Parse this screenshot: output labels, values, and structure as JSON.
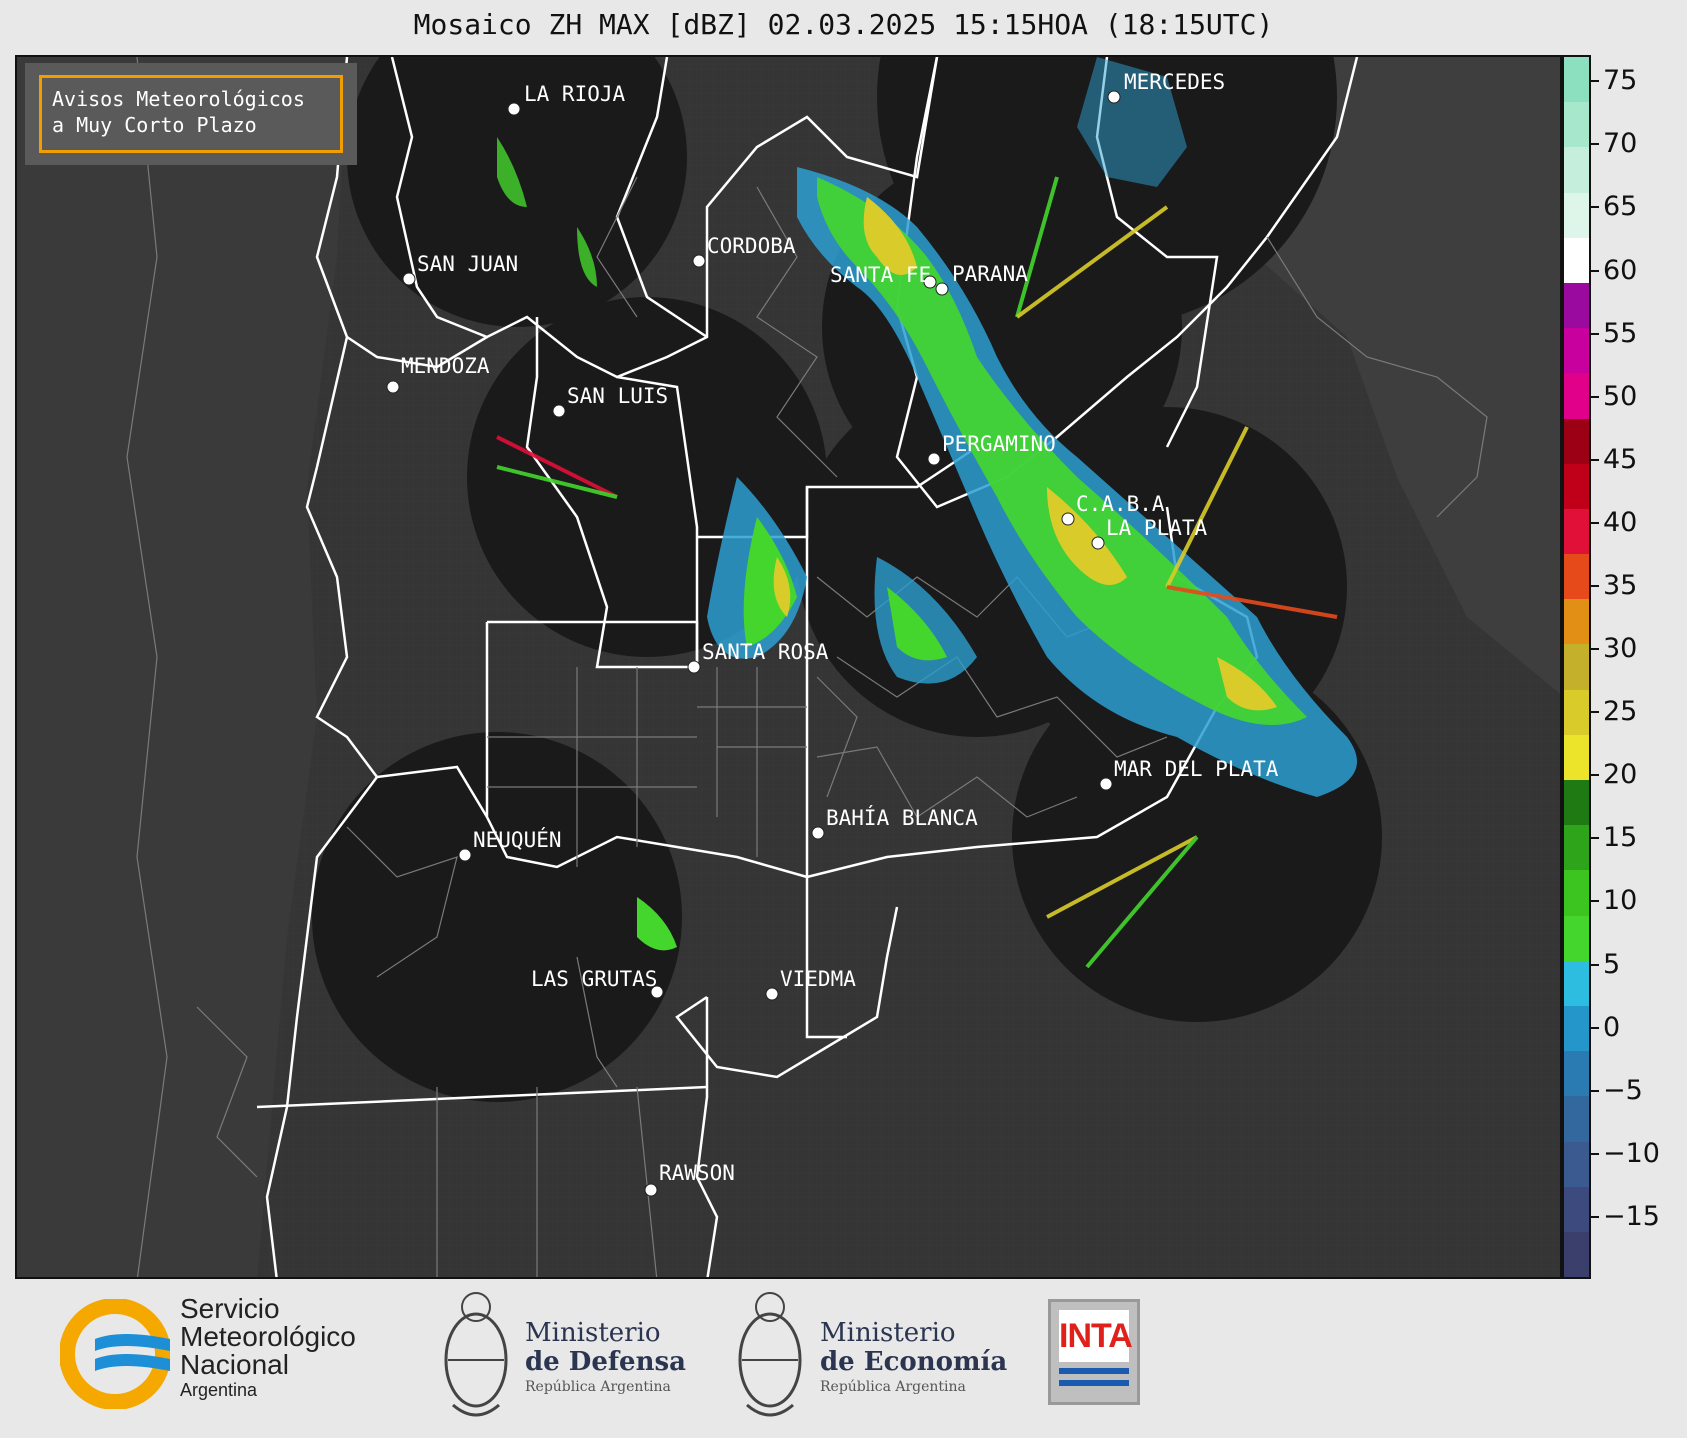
{
  "title": "Mosaico ZH MAX [dBZ] 02.03.2025 15:15HOA (18:15UTC)",
  "notice": {
    "line1": "Avisos Meteorológicos",
    "line2": "a Muy Corto Plazo",
    "border_color": "#f29d00"
  },
  "cities": [
    {
      "name": "LA RIOJA"
    },
    {
      "name": "MERCEDES"
    },
    {
      "name": "CORDOBA"
    },
    {
      "name": "SAN JUAN"
    },
    {
      "name": "SANTA FE"
    },
    {
      "name": "PARANA"
    },
    {
      "name": "MENDOZA"
    },
    {
      "name": "SAN LUIS"
    },
    {
      "name": "PERGAMINO"
    },
    {
      "name": "C.A.B.A"
    },
    {
      "name": "LA PLATA"
    },
    {
      "name": "SANTA ROSA"
    },
    {
      "name": "MAR DEL PLATA"
    },
    {
      "name": "BAHÍA BLANCA"
    },
    {
      "name": "NEUQUÉN"
    },
    {
      "name": "LAS GRUTAS"
    },
    {
      "name": "VIEDMA"
    },
    {
      "name": "RAWSON"
    }
  ],
  "colorbar": {
    "unit": "dBZ",
    "range": [
      -20,
      77
    ],
    "ticks": [
      "75",
      "70",
      "65",
      "60",
      "55",
      "50",
      "45",
      "40",
      "35",
      "30",
      "25",
      "20",
      "15",
      "10",
      "5",
      "0",
      "−5",
      "−10",
      "−15"
    ],
    "colors": [
      "#3b3f6b",
      "#3c4a7e",
      "#3a5a90",
      "#33689f",
      "#2b7bb3",
      "#2596c9",
      "#2dbde0",
      "#44d62c",
      "#3cc421",
      "#2ea41a",
      "#1f7a14",
      "#ece42a",
      "#d9cc2a",
      "#c4b02a",
      "#e28f16",
      "#e64a1a",
      "#e01038",
      "#c00018",
      "#9c0014",
      "#e0008a",
      "#c8009e",
      "#9b0a9e",
      "#ffffff",
      "#def5ea",
      "#c5efdc",
      "#a7e8cd",
      "#8ce0c0"
    ]
  },
  "logos": {
    "smn": {
      "line1": "Servicio",
      "line2": "Meteorológico",
      "line3": "Nacional",
      "line4": "Argentina"
    },
    "defensa": {
      "line1": "Ministerio",
      "line2": "de Defensa",
      "line3": "República Argentina"
    },
    "economia": {
      "line1": "Ministerio",
      "line2": "de Economía",
      "line3": "República Argentina"
    },
    "inta": {
      "label": "INTA"
    }
  }
}
